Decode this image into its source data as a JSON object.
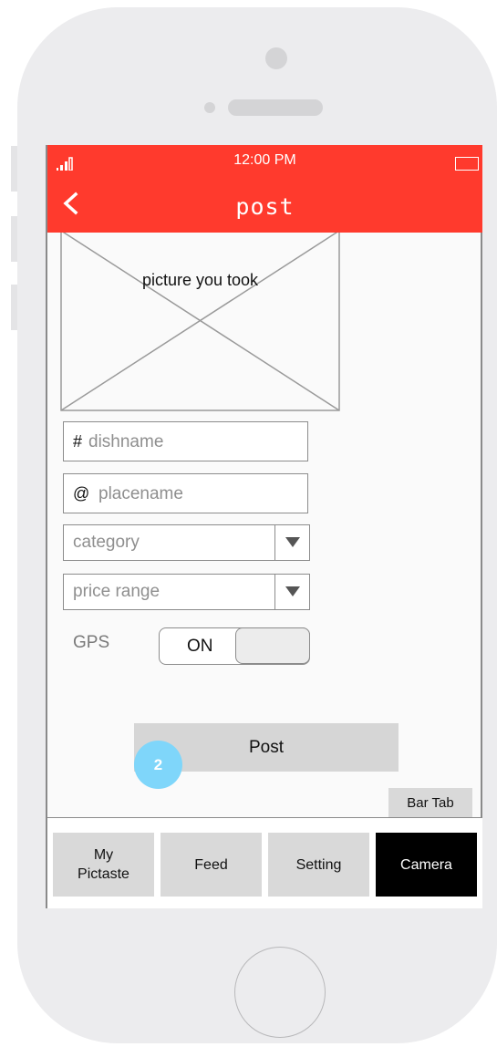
{
  "status_bar": {
    "time": "12:00 PM"
  },
  "nav": {
    "title": "post"
  },
  "photo": {
    "label": "picture you took"
  },
  "form": {
    "dishname": {
      "prefix": "#",
      "placeholder": "dishname"
    },
    "placename": {
      "prefix": "@",
      "placeholder": "placename"
    },
    "category": {
      "value": "category"
    },
    "price_range": {
      "value": "price range"
    },
    "gps": {
      "label": "GPS",
      "state": "ON"
    }
  },
  "post_button": {
    "label": "Post",
    "badge": "2"
  },
  "bar_tab_label": "Bar Tab",
  "tabs": [
    {
      "label": "My\nPictaste",
      "active": false
    },
    {
      "label": "Feed",
      "active": false
    },
    {
      "label": "Setting",
      "active": false
    },
    {
      "label": "Camera",
      "active": true
    }
  ],
  "colors": {
    "accent": "#ff3a2d",
    "badge": "#7fd6fa",
    "tab_active": "#000000"
  }
}
